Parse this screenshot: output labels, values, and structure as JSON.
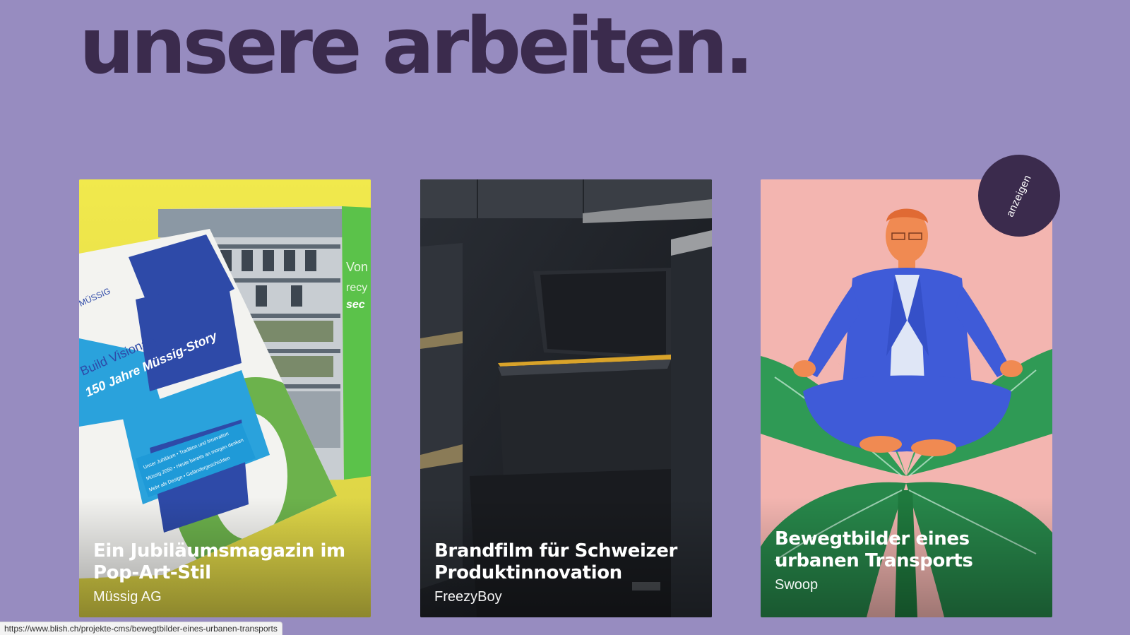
{
  "page": {
    "headline": "unsere arbeiten."
  },
  "projects": [
    {
      "title": "Ein Jubiläumsmagazin im Pop-Art-Stil",
      "client": "Müssig AG",
      "image": {
        "icon": "magazine-image",
        "cover_text": {
          "brand": "MÜSSIG",
          "tagline": "Build Visionary",
          "headline": "150 Jahre Müssig-Story",
          "lines": [
            "Unser Jubiläum • Tradition und Innovation",
            "Müssig 2050 • Heute bereits an morgen denken",
            "Mehr als Design • Geländergeschichten"
          ],
          "page_words": [
            "Von",
            "recy",
            "sec"
          ]
        }
      }
    },
    {
      "title": "Brandfilm für Schweizer Produktinnovation",
      "client": "FreezyBoy",
      "image": {
        "icon": "product-photo-image"
      }
    },
    {
      "title": "Bewegtbilder eines urbanen Transports",
      "client": "Swoop",
      "image": {
        "icon": "meditating-man-illustration"
      }
    }
  ],
  "badge": {
    "label": "anzeigen"
  },
  "status_bar": {
    "url": "https://www.blish.ch/projekte-cms/bewegtbilder-eines-urbanen-transports"
  },
  "colors": {
    "background": "#978cc0",
    "headline": "#3b2b4d",
    "badge": "#3b2b4d",
    "card_1": "#e8e14d",
    "card_2": "#1d2026",
    "card_3": "#f3b5b0"
  }
}
